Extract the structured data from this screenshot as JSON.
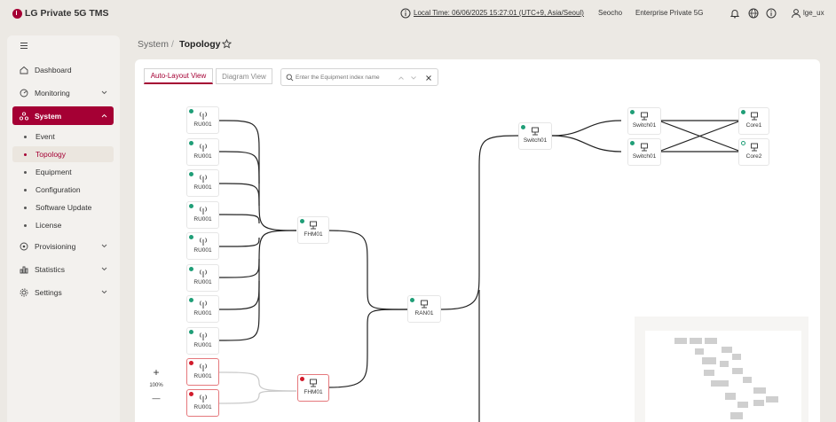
{
  "header": {
    "brand": "LG Private 5G TMS",
    "local_time": "Local Time: 06/06/2025 15:27:01 (UTC+9, Asia/Seoul)",
    "site": "Seocho",
    "product": "Enterprise Private 5G",
    "user": "lge_ux",
    "icons": [
      "info-icon",
      "bell-icon",
      "globe-icon",
      "info-icon",
      "user-icon"
    ]
  },
  "sidebar": {
    "items": [
      {
        "label": "Dashboard",
        "icon": "home-icon"
      },
      {
        "label": "Monitoring",
        "icon": "monitoring-icon"
      },
      {
        "label": "System",
        "icon": "system-icon",
        "active": true
      },
      {
        "label": "Provisioning",
        "icon": "provisioning-icon"
      },
      {
        "label": "Statistics",
        "icon": "chart-icon"
      },
      {
        "label": "Settings",
        "icon": "gear-icon"
      }
    ],
    "system_sub": [
      "Event",
      "Topology",
      "Equipment",
      "Configuration",
      "Software Update",
      "License"
    ]
  },
  "breadcrumb": {
    "parent": "System",
    "sep": "/",
    "current": "Topology"
  },
  "toolbar": {
    "tab_auto": "Auto-Layout View",
    "tab_diagram": "Diagram View",
    "search_placeholder": "Enter the Equipment index name"
  },
  "topology": {
    "ru_nodes": [
      "RU001",
      "RU001",
      "RU001",
      "RU001",
      "RU001",
      "RU001",
      "RU001",
      "RU001",
      "RU001",
      "RU001"
    ],
    "fhm_nodes": [
      "FHM01",
      "FHM01"
    ],
    "ran": "RAN01",
    "switch_top": "Switch01",
    "switches": [
      "Switch01",
      "Switch01"
    ],
    "cores": [
      "Core1",
      "Core2"
    ]
  },
  "zoom": {
    "plus": "+",
    "level": "100%",
    "minus": "—"
  },
  "colors": {
    "accent": "#a50034",
    "ok": "#1f9e77",
    "alarm": "#d11b2b"
  }
}
